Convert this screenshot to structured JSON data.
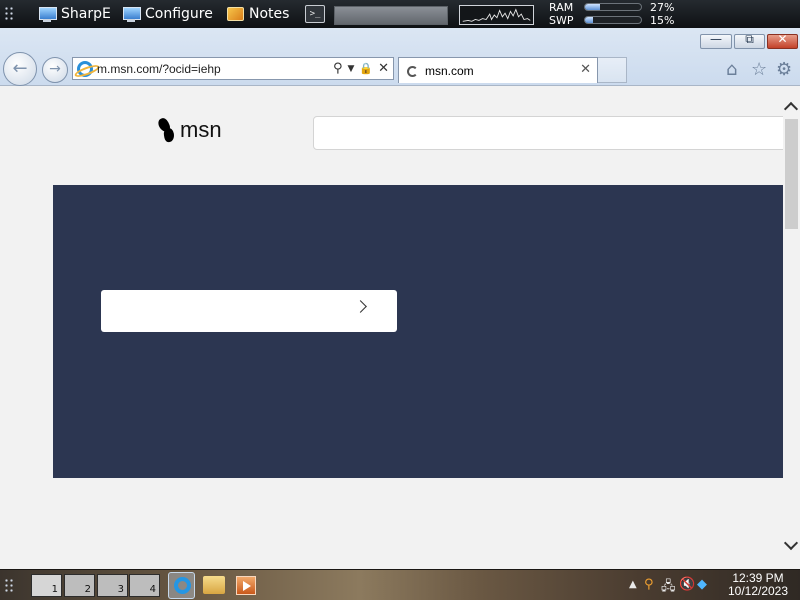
{
  "topbar": {
    "apps": [
      {
        "label": "SharpE"
      },
      {
        "label": "Configure"
      },
      {
        "label": "Notes"
      }
    ],
    "terminal_glyph": ">_",
    "meters": [
      {
        "label": "RAM",
        "value": "27%",
        "fraction": 0.27
      },
      {
        "label": "SWP",
        "value": "15%",
        "fraction": 0.15
      }
    ]
  },
  "browser": {
    "url": "m.msn.com/?ocid=iehp",
    "tab_title": "msn.com",
    "controls": {
      "minimize": "—",
      "restore": "⧉",
      "close": "✕"
    },
    "nav": {
      "back": "←",
      "forward": "→"
    },
    "toolbar_icons": [
      "home-icon",
      "favorites-icon",
      "settings-icon"
    ]
  },
  "page": {
    "logo_text": "msn",
    "colors": {
      "hero": "#2c3651",
      "background": "#f2f2f2"
    }
  },
  "taskbar": {
    "desktops": [
      "1",
      "2",
      "3",
      "4"
    ],
    "active_desktop": "1",
    "apps": [
      "internet-explorer-icon",
      "file-explorer-icon",
      "media-player-icon"
    ],
    "clock": {
      "time": "12:39 PM",
      "date": "10/12/2023"
    }
  }
}
